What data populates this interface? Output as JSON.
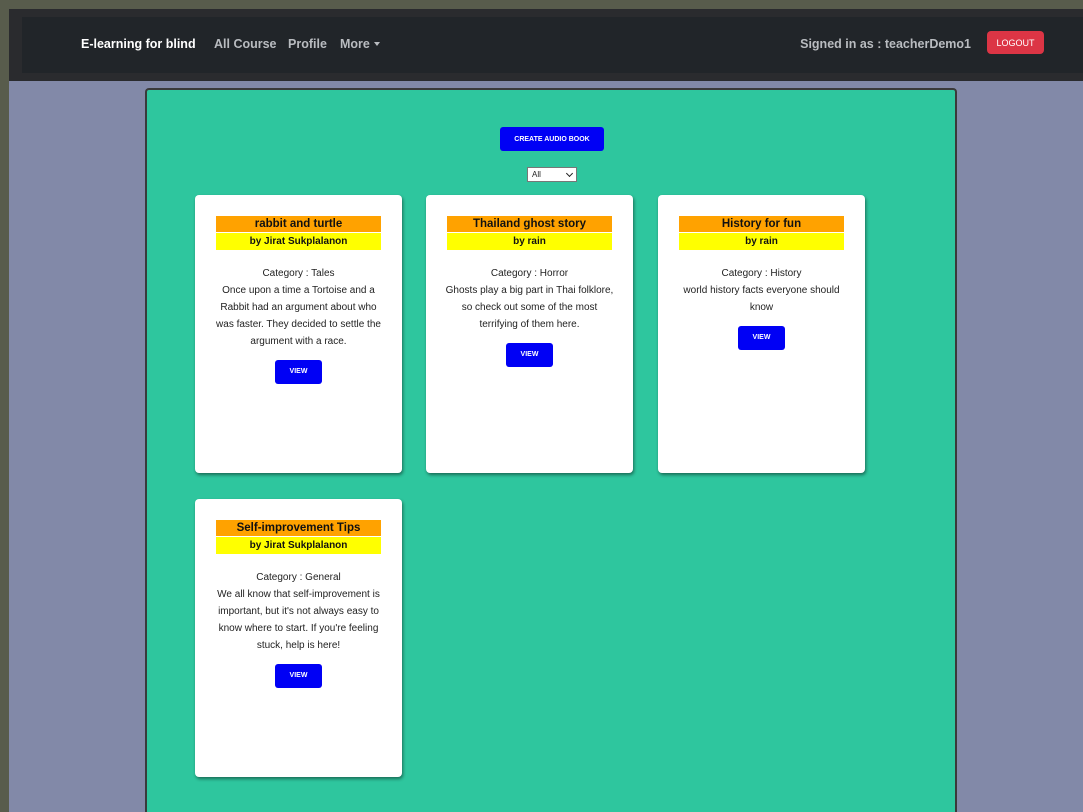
{
  "navbar": {
    "brand": "E-learning for blind",
    "links": [
      "All Course",
      "Profile",
      "More"
    ],
    "signed_in_text": "Signed in as : teacherDemo1",
    "logout_label": "LOGOUT"
  },
  "toolbar": {
    "create_label": "CREATE AUDIO BOOK",
    "filter_value": "All"
  },
  "cards": [
    {
      "title": "rabbit and turtle",
      "author": "by Jirat Sukplalanon",
      "category": "Category : Tales",
      "description": "Once upon a time a Tortoise and a Rabbit had an argument about who was faster. They decided to settle the argument with a race.",
      "view_label": "VIEW"
    },
    {
      "title": "Thailand ghost story",
      "author": "by rain",
      "category": "Category : Horror",
      "description": "Ghosts play a big part in Thai folklore, so check out some of the most terrifying of them here.",
      "view_label": "VIEW"
    },
    {
      "title": "History for fun",
      "author": "by rain",
      "category": "Category : History",
      "description": "world history facts everyone should know",
      "view_label": "VIEW"
    },
    {
      "title": "Self-improvement Tips",
      "author": "by Jirat Sukplalanon",
      "category": "Category : General",
      "description": "We all know that self-improvement is important, but it's not always easy to know where to start. If you're feeling stuck, help is here!",
      "view_label": "VIEW"
    }
  ],
  "colors": {
    "panel": "#2ec69e",
    "page_bg": "#8289a8",
    "title_bar": "#ffa200",
    "author_bar": "#ffff00",
    "button_blue": "#0000f5",
    "logout_red": "#dc3545"
  }
}
